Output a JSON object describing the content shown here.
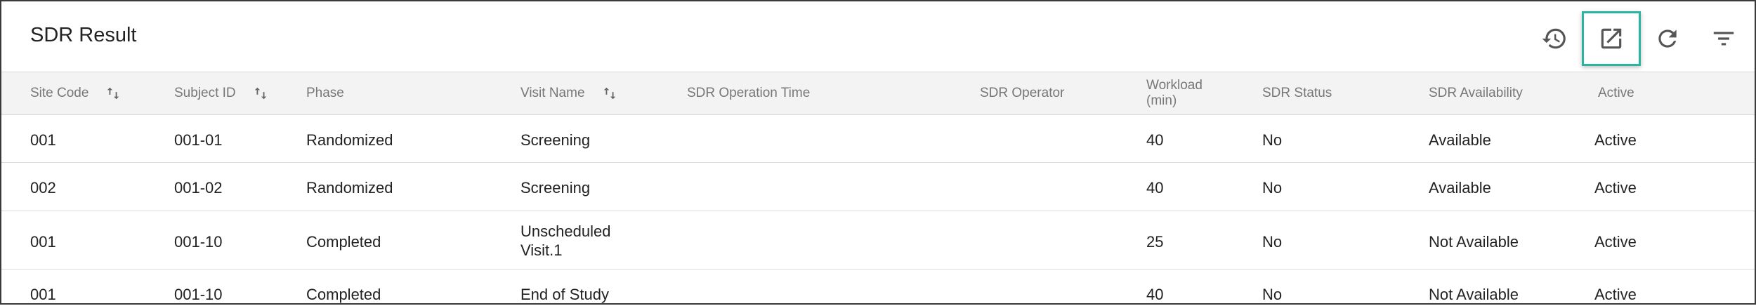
{
  "title": "SDR Result",
  "toolbar": {
    "history_icon": "history-icon",
    "export_icon": "open-in-new-icon",
    "refresh_icon": "refresh-icon",
    "filter_icon": "filter-icon",
    "accent_color": "#2bb5a0"
  },
  "columns": [
    {
      "label": "Site Code",
      "sortable": true
    },
    {
      "label": "Subject ID",
      "sortable": true
    },
    {
      "label": "Phase",
      "sortable": false
    },
    {
      "label": "Visit Name",
      "sortable": true
    },
    {
      "label": "SDR Operation Time",
      "sortable": false
    },
    {
      "label": "SDR Operator",
      "sortable": false
    },
    {
      "label": "Workload",
      "label2": "(min)",
      "sortable": false
    },
    {
      "label": "SDR Status",
      "sortable": false
    },
    {
      "label": "SDR Availability",
      "sortable": false
    },
    {
      "label": "Active",
      "sortable": false
    }
  ],
  "rows": [
    {
      "site_code": "001",
      "subject_id": "001-01",
      "phase": "Randomized",
      "visit_name": "Screening",
      "visit_name2": "",
      "op_time": "",
      "operator": "",
      "workload": "40",
      "status": "No",
      "availability": "Available",
      "active": "Active"
    },
    {
      "site_code": "002",
      "subject_id": "001-02",
      "phase": "Randomized",
      "visit_name": "Screening",
      "visit_name2": "",
      "op_time": "",
      "operator": "",
      "workload": "40",
      "status": "No",
      "availability": "Available",
      "active": "Active"
    },
    {
      "site_code": "001",
      "subject_id": "001-10",
      "phase": "Completed",
      "visit_name": "Unscheduled",
      "visit_name2": "Visit.1",
      "op_time": "",
      "operator": "",
      "workload": "25",
      "status": "No",
      "availability": "Not Available",
      "active": "Active"
    },
    {
      "site_code": "001",
      "subject_id": "001-10",
      "phase": "Completed",
      "visit_name": "End of Study",
      "visit_name2": "",
      "op_time": "",
      "operator": "",
      "workload": "40",
      "status": "No",
      "availability": "Not Available",
      "active": "Active"
    }
  ]
}
